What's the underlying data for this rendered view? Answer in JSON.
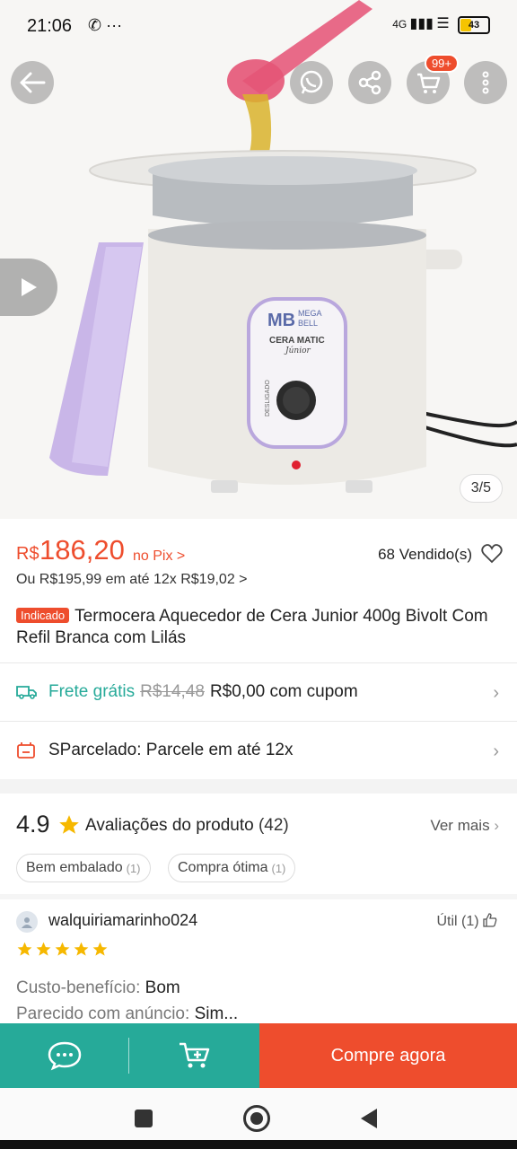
{
  "status_bar": {
    "time": "21:06",
    "network": "4G",
    "battery": "43",
    "battery_level": 0.43
  },
  "product_image": {
    "counter": "3/5",
    "cart_badge": "99+"
  },
  "price": {
    "currency": "R$",
    "value": "186,20",
    "pix_label": "no Pix >",
    "sold": "68 Vendido(s)",
    "installment": "Ou R$195,99 em até 12x R$19,02 >"
  },
  "title": {
    "tag": "Indicado",
    "text": "Termocera Aquecedor de Cera Junior 400g  Bivolt Com Refil Branca com Lilás"
  },
  "shipping": {
    "label": "Frete grátis",
    "old_price": "R$14,48",
    "value": "R$0,00 com cupom"
  },
  "sparcelado": {
    "text": "SParcelado: Parcele em até 12x"
  },
  "ratings": {
    "score": "4.9",
    "label": "Avaliações do produto",
    "count": "(42)",
    "ver_mais": "Ver mais",
    "chips": [
      {
        "label": "Bem embalado",
        "count": "(1)"
      },
      {
        "label": "Compra ótima",
        "count": "(1)"
      }
    ]
  },
  "review": {
    "user": "walquiriamarinho024",
    "util": "Útil (1)",
    "stars": 5,
    "line1_label": "Custo-benefício:",
    "line1_value": "Bom",
    "line2_label": "Parecido com anúncio:",
    "line2_value": "Sim..."
  },
  "actions": {
    "buy_now": "Compre agora"
  },
  "product_label": {
    "brand1": "MEGA",
    "brand2": "BELL",
    "model": "CERA MATIC",
    "sub": "Júnior",
    "off": "DESLIGADO"
  },
  "colors": {
    "accent": "#ee4d2d",
    "teal": "#26aa99",
    "lilac": "#c9b6e8"
  }
}
